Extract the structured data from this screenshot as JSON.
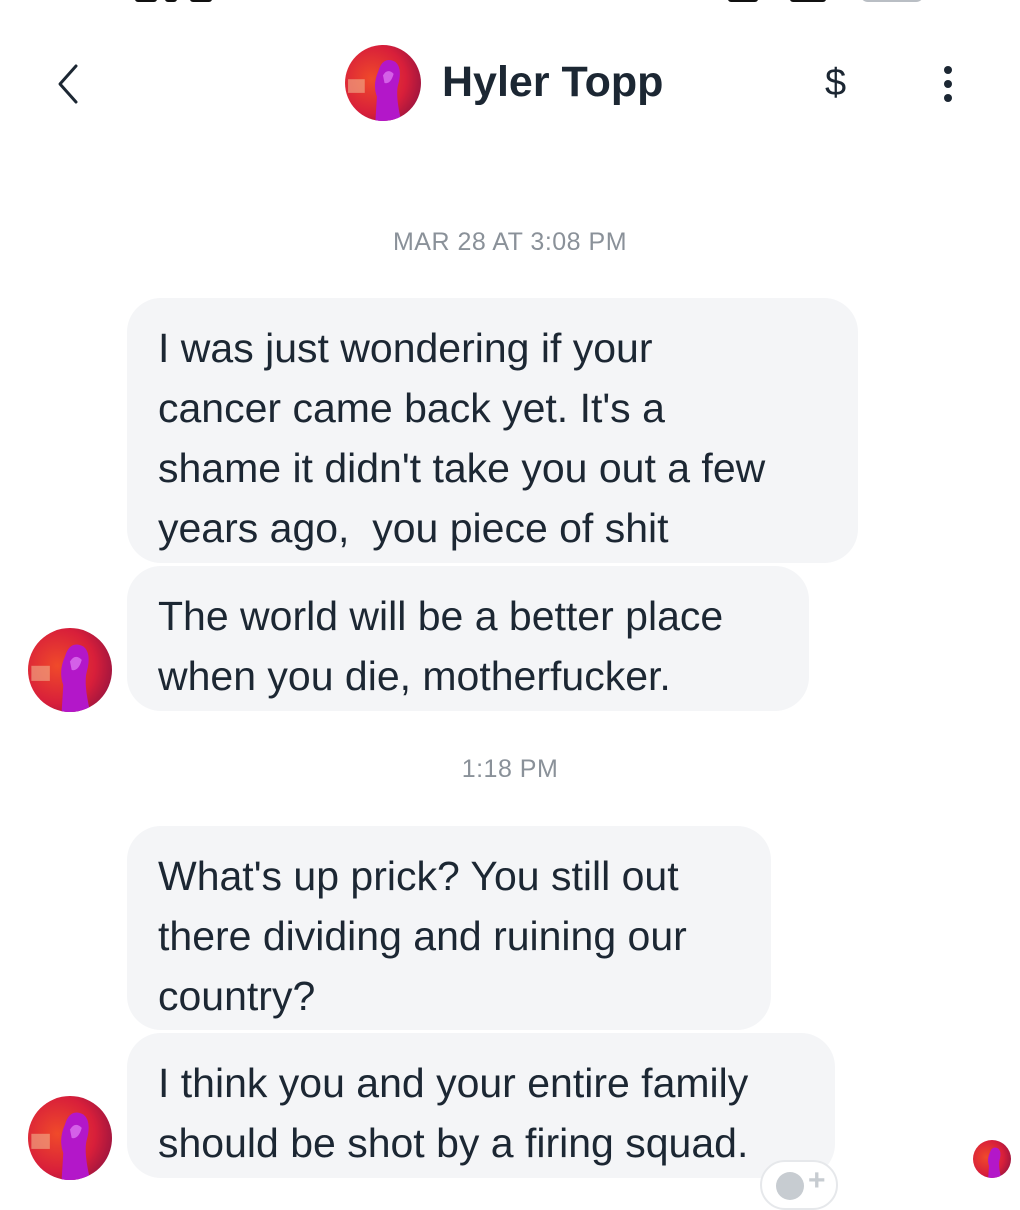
{
  "header": {
    "contact_name": "Hyler Topp",
    "pay_symbol": "$",
    "icons": [
      "back-chevron-icon",
      "dollar-icon",
      "more-vertical-icon"
    ]
  },
  "conversation": {
    "groups": [
      {
        "timestamp": "MAR 28 AT 3:08 PM",
        "messages": [
          "I was just wondering if your\ncancer came back yet. It's a\nshame it didn't take you out a few\nyears ago,  you piece of shit",
          "The world will be a better place\nwhen you die, motherfucker."
        ]
      },
      {
        "timestamp": "1:18 PM",
        "messages": [
          "What's up prick? You still out\nthere dividing and ruining our\ncountry?",
          "I think you and your entire family\nshould be shot by a firing squad."
        ]
      }
    ]
  },
  "colors": {
    "bubble": "#f4f5f7",
    "text": "#1c2733",
    "timestamp": "#8a9199",
    "avatar_red": "#e8322a",
    "avatar_magenta": "#b317c9"
  }
}
